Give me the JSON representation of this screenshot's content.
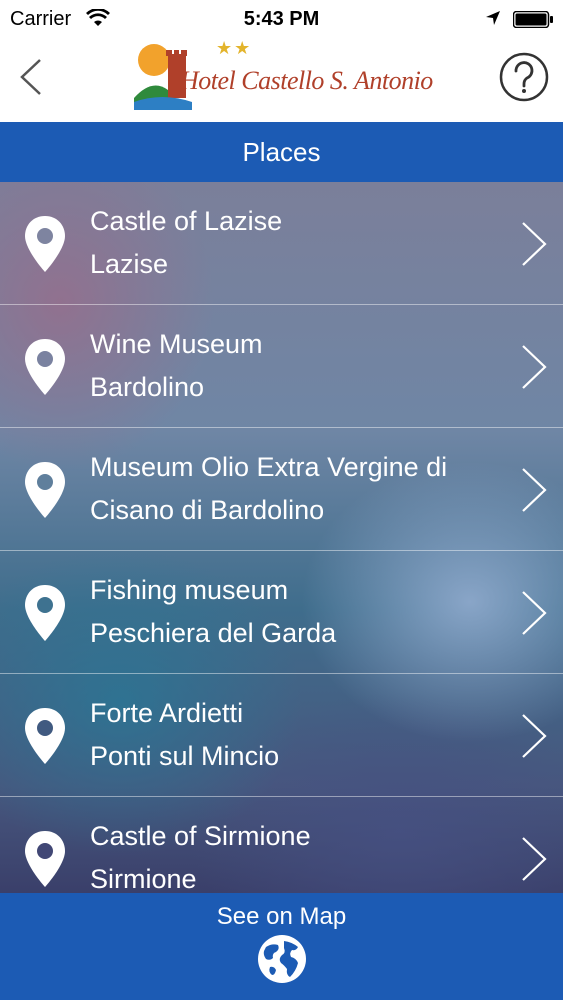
{
  "status_bar": {
    "carrier": "Carrier",
    "time": "5:43 PM"
  },
  "header": {
    "logo_text": "Hotel Castello S. Antonio",
    "logo_stars": "★★",
    "back_icon": "chevron-left-icon",
    "help_icon": "question-circle-icon"
  },
  "title_bar": {
    "title": "Places"
  },
  "places": [
    {
      "name": "Castle of Lazise",
      "town": "Lazise"
    },
    {
      "name": "Wine Museum",
      "town": "Bardolino"
    },
    {
      "name": "Museum Olio Extra Vergine di",
      "town": "Cisano di Bardolino"
    },
    {
      "name": "Fishing museum",
      "town": "Peschiera del Garda"
    },
    {
      "name": "Forte Ardietti",
      "town": "Ponti sul Mincio"
    },
    {
      "name": "Castle of Sirmione",
      "town": "Sirmione"
    }
  ],
  "bottom_bar": {
    "label": "See on Map",
    "icon": "globe-icon"
  },
  "colors": {
    "accent_blue": "#1c5bb4",
    "logo_red": "#b0402a",
    "star_gold": "#e3b42c"
  }
}
